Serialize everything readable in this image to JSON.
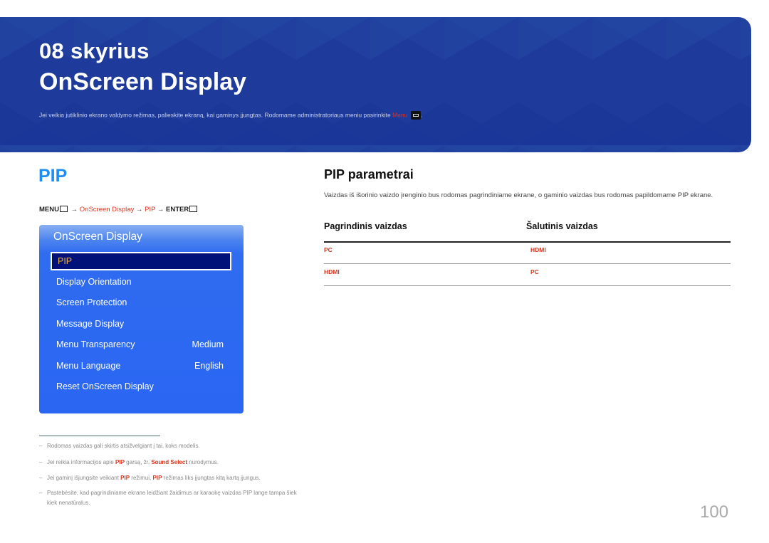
{
  "banner": {
    "chapter": "08 skyrius",
    "title": "OnScreen Display",
    "note_before": "Jei veikia jutiklinio ekrano valdymo režimas, palieskite ekraną, kai gaminys įjungtas. Rodomame administratoriaus meniu pasirinkite ",
    "note_highlight": "Menu",
    "note_after": ".",
    "menu_key_icon": "menu-key-icon"
  },
  "section": {
    "title": "PIP",
    "path": {
      "menu": "MENU",
      "arrow1": " → ",
      "item1": "OnScreen Display",
      "arrow2": " → ",
      "item2": "PIP",
      "arrow3": " → ",
      "enter": "ENTER"
    }
  },
  "osd": {
    "title": "OnScreen Display",
    "selected": "PIP",
    "items": [
      {
        "label": "Display Orientation",
        "value": ""
      },
      {
        "label": "Screen Protection",
        "value": ""
      },
      {
        "label": "Message Display",
        "value": ""
      },
      {
        "label": "Menu Transparency",
        "value": "Medium"
      },
      {
        "label": "Menu Language",
        "value": "English"
      },
      {
        "label": "Reset OnScreen Display",
        "value": ""
      }
    ]
  },
  "right": {
    "heading": "PIP parametrai",
    "description": "Vaizdas iš išorinio vaizdo įrenginio bus rodomas pagrindiniame ekrane, o gaminio vaizdas bus rodomas papildomame PIP ekrane.",
    "table": {
      "headers": [
        "Pagrindinis vaizdas",
        "Šalutinis vaizdas"
      ],
      "rows": [
        [
          "PC",
          "HDMI"
        ],
        [
          "HDMI",
          "PC"
        ]
      ]
    }
  },
  "footnotes": {
    "dash": "–",
    "n1": "Rodomas vaizdas gali skirtis atsižvelgiant į tai, koks modelis.",
    "n2_a": "Jei reikia informacijos apie ",
    "n2_b": "PIP",
    "n2_c": " garsą, žr. ",
    "n2_d": "Sound Select",
    "n2_e": " nurodymus.",
    "n3_a": "Jei gaminį išjungsite veikiant ",
    "n3_b": "PIP",
    "n3_c": " režimui, ",
    "n3_d": "PIP",
    "n3_e": " režimas liks įjungtas kitą kartą įjungus.",
    "n4": "Pastebėsite, kad pagrindiniame ekrane leidžiant žaidimus ar karaokę vaizdas PIP lange tampa šiek kiek nenatūralus."
  },
  "page_number": "100",
  "colors": {
    "banner": "#1e3a9a",
    "accent_blue": "#1f8ef1",
    "accent_red": "#d9361e",
    "osd_bg": "#2a66f2",
    "osd_selected": "#00127a",
    "osd_selected_text": "#f2b13a"
  }
}
